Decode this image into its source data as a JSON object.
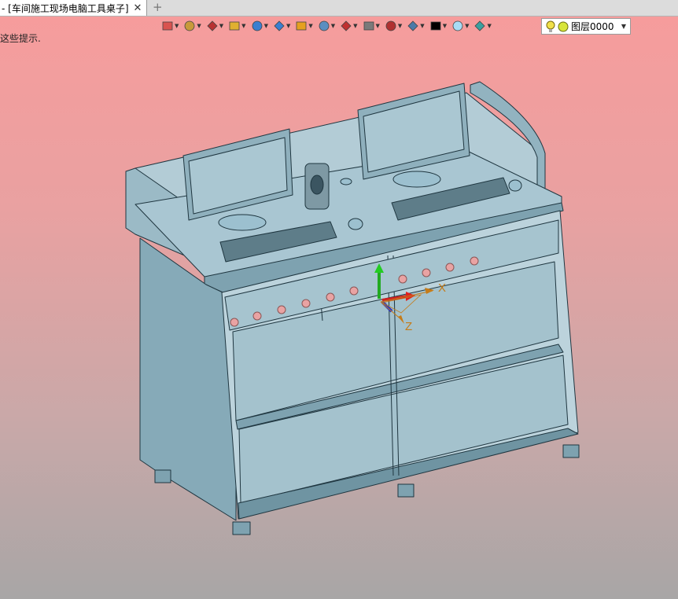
{
  "tab": {
    "title": "- [车间施工现场电脑工具桌子]",
    "close_glyph": "✕",
    "add_glyph": "+"
  },
  "hint": "这些提示.",
  "toolbar": {
    "buttons": [
      {
        "name": "exit-sketch-icon",
        "color": "#d9534f"
      },
      {
        "name": "pencil-brush-icon",
        "color": "#c89a3a"
      },
      {
        "name": "smart-pen-icon",
        "color": "#b83232"
      },
      {
        "name": "render-mode-icon",
        "color": "#e0b030"
      },
      {
        "name": "cube-view-icon",
        "color": "#3a7fd0"
      },
      {
        "name": "view-orient-icon",
        "color": "#3a7fd0"
      },
      {
        "name": "section-view-icon",
        "color": "#e5a020"
      },
      {
        "name": "fit-view-icon",
        "color": "#5c8ec0"
      },
      {
        "name": "snap-target-icon",
        "color": "#c03030"
      },
      {
        "name": "grid-toggle-icon",
        "color": "#7a7a7a"
      },
      {
        "name": "dimension-icon",
        "color": "#b03030"
      },
      {
        "name": "camera-icon",
        "color": "#4a7aa8"
      },
      {
        "name": "line-color-icon",
        "color": "#000000"
      },
      {
        "name": "fill-color-icon",
        "color": "#a8dcf5"
      },
      {
        "name": "layer-stack-icon",
        "color": "#3aa0a0"
      }
    ]
  },
  "layer": {
    "name": "图层0000",
    "bulb_color": "#f1e04a",
    "status_color": "#d8e53a"
  },
  "axes": {
    "x": "X",
    "z": "Z"
  },
  "colors": {
    "model_face": "#9cc0cf",
    "model_edge": "#1f3640",
    "axis_orange": "#c57b18"
  }
}
